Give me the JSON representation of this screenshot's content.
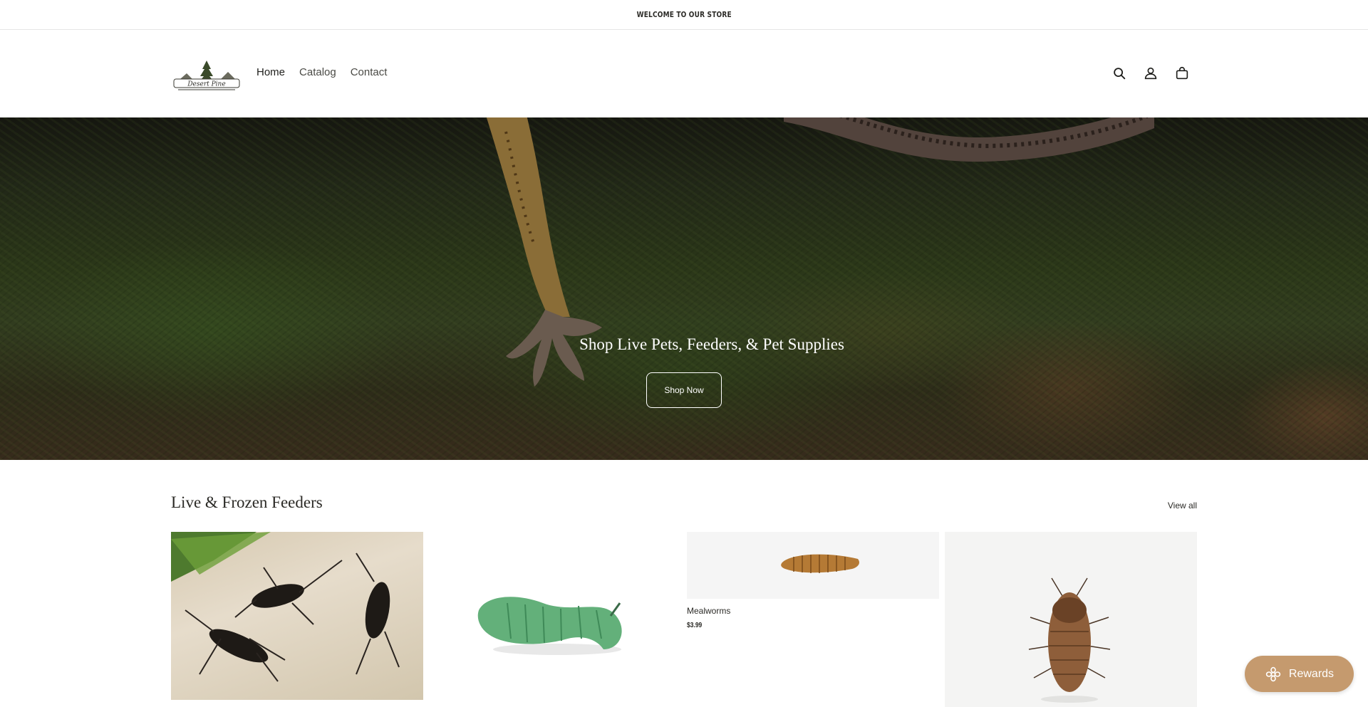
{
  "announcement": {
    "text": "WELCOME TO OUR STORE"
  },
  "header": {
    "logo_text": "Desert Pine",
    "nav": [
      {
        "label": "Home",
        "active": true
      },
      {
        "label": "Catalog",
        "active": false
      },
      {
        "label": "Contact",
        "active": false
      }
    ],
    "icons": [
      "search-icon",
      "account-icon",
      "cart-icon"
    ]
  },
  "hero": {
    "title": "Shop Live Pets, Feeders, & Pet Supplies",
    "button_label": "Shop Now"
  },
  "collection": {
    "title": "Live & Frozen Feeders",
    "view_all": "View all",
    "products": [
      {
        "image": "crickets"
      },
      {
        "image": "hornworm"
      },
      {
        "image": "mealworm",
        "title": "Mealworms",
        "price": "$3.99"
      },
      {
        "image": "dubia-roach"
      }
    ]
  },
  "rewards": {
    "label": "Rewards",
    "color": "#c59a6e"
  }
}
